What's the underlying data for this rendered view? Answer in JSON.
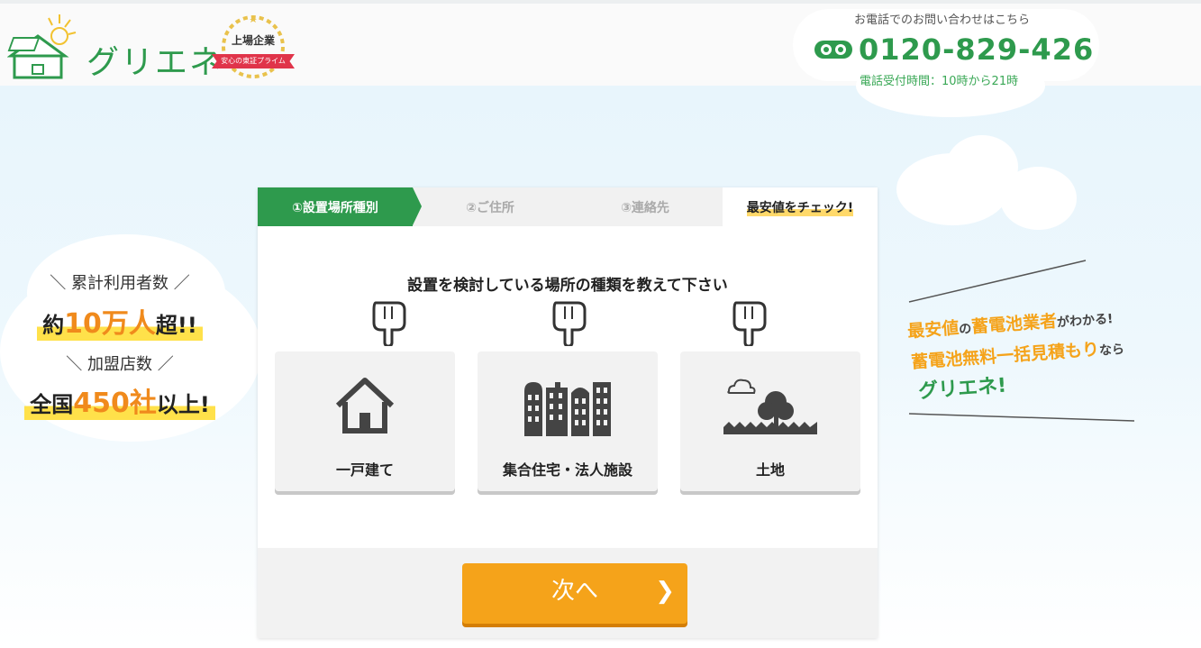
{
  "header": {
    "logo_text": "グリエネ",
    "badge_title": "上場企業",
    "badge_ribbon": "安心の東証プライム",
    "phone_note": "お電話でのお問い合わせはこちら",
    "phone_number": "0120-829-426",
    "phone_hours": "電話受付時間：10時から21時"
  },
  "left_ad": {
    "users_label": "累計利用者数",
    "users_prefix": "約",
    "users_value": "10万人",
    "users_suffix": "超!!",
    "stores_label": "加盟店数",
    "stores_prefix": "全国",
    "stores_value": "450社",
    "stores_suffix": "以上!"
  },
  "steps": [
    {
      "label": "①設置場所種別"
    },
    {
      "label": "②ご住所"
    },
    {
      "label": "③連絡先"
    },
    {
      "label": "最安値をチェック!"
    }
  ],
  "question": "設置を検討している場所の種類を教えて下さい",
  "options": [
    {
      "label": "一戸建て",
      "icon": "house-icon"
    },
    {
      "label": "集合住宅・法人施設",
      "icon": "buildings-icon"
    },
    {
      "label": "土地",
      "icon": "land-icon"
    }
  ],
  "next_button": {
    "label": "次へ",
    "arrow": "❯"
  },
  "right_ad": {
    "line1a": "最安値",
    "line1b": "の",
    "line1c": "蓄電池業者",
    "line1d": "がわかる!",
    "line2a": "蓄電池無料一括見積もり",
    "line2b": "なら",
    "line3": "グリエネ!"
  },
  "colors": {
    "brand_green": "#2e9a4d",
    "accent_orange": "#f5a31a",
    "highlight_yellow": "#ffe14a"
  }
}
